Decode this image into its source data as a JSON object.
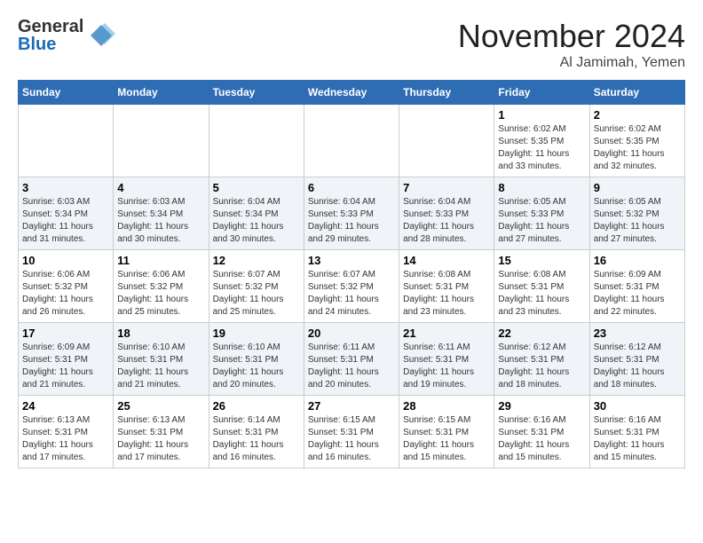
{
  "header": {
    "logo_line1": "General",
    "logo_line2": "Blue",
    "month": "November 2024",
    "location": "Al Jamimah, Yemen"
  },
  "days_of_week": [
    "Sunday",
    "Monday",
    "Tuesday",
    "Wednesday",
    "Thursday",
    "Friday",
    "Saturday"
  ],
  "weeks": [
    [
      {
        "day": "",
        "info": ""
      },
      {
        "day": "",
        "info": ""
      },
      {
        "day": "",
        "info": ""
      },
      {
        "day": "",
        "info": ""
      },
      {
        "day": "",
        "info": ""
      },
      {
        "day": "1",
        "info": "Sunrise: 6:02 AM\nSunset: 5:35 PM\nDaylight: 11 hours and 33 minutes."
      },
      {
        "day": "2",
        "info": "Sunrise: 6:02 AM\nSunset: 5:35 PM\nDaylight: 11 hours and 32 minutes."
      }
    ],
    [
      {
        "day": "3",
        "info": "Sunrise: 6:03 AM\nSunset: 5:34 PM\nDaylight: 11 hours and 31 minutes."
      },
      {
        "day": "4",
        "info": "Sunrise: 6:03 AM\nSunset: 5:34 PM\nDaylight: 11 hours and 30 minutes."
      },
      {
        "day": "5",
        "info": "Sunrise: 6:04 AM\nSunset: 5:34 PM\nDaylight: 11 hours and 30 minutes."
      },
      {
        "day": "6",
        "info": "Sunrise: 6:04 AM\nSunset: 5:33 PM\nDaylight: 11 hours and 29 minutes."
      },
      {
        "day": "7",
        "info": "Sunrise: 6:04 AM\nSunset: 5:33 PM\nDaylight: 11 hours and 28 minutes."
      },
      {
        "day": "8",
        "info": "Sunrise: 6:05 AM\nSunset: 5:33 PM\nDaylight: 11 hours and 27 minutes."
      },
      {
        "day": "9",
        "info": "Sunrise: 6:05 AM\nSunset: 5:32 PM\nDaylight: 11 hours and 27 minutes."
      }
    ],
    [
      {
        "day": "10",
        "info": "Sunrise: 6:06 AM\nSunset: 5:32 PM\nDaylight: 11 hours and 26 minutes."
      },
      {
        "day": "11",
        "info": "Sunrise: 6:06 AM\nSunset: 5:32 PM\nDaylight: 11 hours and 25 minutes."
      },
      {
        "day": "12",
        "info": "Sunrise: 6:07 AM\nSunset: 5:32 PM\nDaylight: 11 hours and 25 minutes."
      },
      {
        "day": "13",
        "info": "Sunrise: 6:07 AM\nSunset: 5:32 PM\nDaylight: 11 hours and 24 minutes."
      },
      {
        "day": "14",
        "info": "Sunrise: 6:08 AM\nSunset: 5:31 PM\nDaylight: 11 hours and 23 minutes."
      },
      {
        "day": "15",
        "info": "Sunrise: 6:08 AM\nSunset: 5:31 PM\nDaylight: 11 hours and 23 minutes."
      },
      {
        "day": "16",
        "info": "Sunrise: 6:09 AM\nSunset: 5:31 PM\nDaylight: 11 hours and 22 minutes."
      }
    ],
    [
      {
        "day": "17",
        "info": "Sunrise: 6:09 AM\nSunset: 5:31 PM\nDaylight: 11 hours and 21 minutes."
      },
      {
        "day": "18",
        "info": "Sunrise: 6:10 AM\nSunset: 5:31 PM\nDaylight: 11 hours and 21 minutes."
      },
      {
        "day": "19",
        "info": "Sunrise: 6:10 AM\nSunset: 5:31 PM\nDaylight: 11 hours and 20 minutes."
      },
      {
        "day": "20",
        "info": "Sunrise: 6:11 AM\nSunset: 5:31 PM\nDaylight: 11 hours and 20 minutes."
      },
      {
        "day": "21",
        "info": "Sunrise: 6:11 AM\nSunset: 5:31 PM\nDaylight: 11 hours and 19 minutes."
      },
      {
        "day": "22",
        "info": "Sunrise: 6:12 AM\nSunset: 5:31 PM\nDaylight: 11 hours and 18 minutes."
      },
      {
        "day": "23",
        "info": "Sunrise: 6:12 AM\nSunset: 5:31 PM\nDaylight: 11 hours and 18 minutes."
      }
    ],
    [
      {
        "day": "24",
        "info": "Sunrise: 6:13 AM\nSunset: 5:31 PM\nDaylight: 11 hours and 17 minutes."
      },
      {
        "day": "25",
        "info": "Sunrise: 6:13 AM\nSunset: 5:31 PM\nDaylight: 11 hours and 17 minutes."
      },
      {
        "day": "26",
        "info": "Sunrise: 6:14 AM\nSunset: 5:31 PM\nDaylight: 11 hours and 16 minutes."
      },
      {
        "day": "27",
        "info": "Sunrise: 6:15 AM\nSunset: 5:31 PM\nDaylight: 11 hours and 16 minutes."
      },
      {
        "day": "28",
        "info": "Sunrise: 6:15 AM\nSunset: 5:31 PM\nDaylight: 11 hours and 15 minutes."
      },
      {
        "day": "29",
        "info": "Sunrise: 6:16 AM\nSunset: 5:31 PM\nDaylight: 11 hours and 15 minutes."
      },
      {
        "day": "30",
        "info": "Sunrise: 6:16 AM\nSunset: 5:31 PM\nDaylight: 11 hours and 15 minutes."
      }
    ]
  ]
}
